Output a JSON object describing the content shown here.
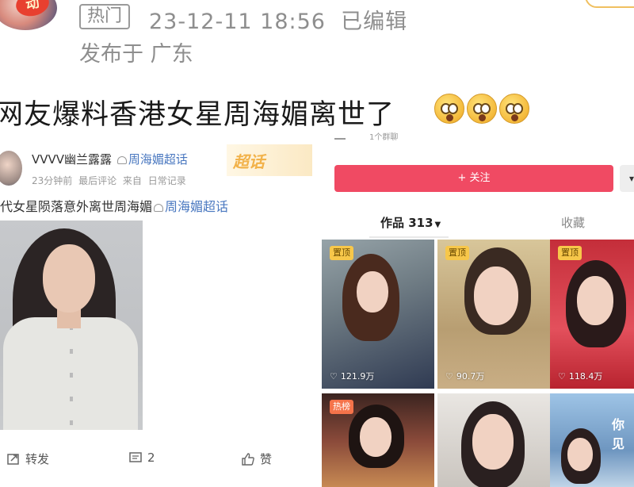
{
  "post": {
    "hot_tag": "热门",
    "timestamp": "23-12-11 18:56",
    "edited": "已编辑",
    "location": "发布于 广东",
    "avatar_badge_text": "动",
    "headline": "网友爆料香港女星周海媚离世了"
  },
  "embedded_post": {
    "username": "VVVV幽兰露露",
    "topic_link": "周海媚超话",
    "badge": "超话",
    "meta": "23分钟前 最后评论 来自 日常记录",
    "content_text": "代女星陨落意外离世周海媚",
    "content_topic": "周海媚超话",
    "actions": {
      "repost": "转发",
      "comments": "2",
      "like": "赞"
    }
  },
  "profile": {
    "top_meta": "1个群聊",
    "follow_button": "+ 关注",
    "follow_side": "▾",
    "tabs": {
      "works": "作品 313",
      "favorites": "收藏"
    },
    "tiles": [
      {
        "badge": "置顶",
        "likes": "121.9万"
      },
      {
        "badge": "置顶",
        "likes": "90.7万"
      },
      {
        "badge": "置顶",
        "likes": "118.4万"
      },
      {
        "badge": "热榜",
        "likes": ""
      },
      {
        "badge": "",
        "likes": ""
      },
      {
        "badge": "",
        "likes": "",
        "banner": "你见"
      }
    ]
  },
  "colors": {
    "follow": "#f04a63",
    "topic_link": "#4a78c0",
    "badge_gold": "#f2b24a"
  }
}
